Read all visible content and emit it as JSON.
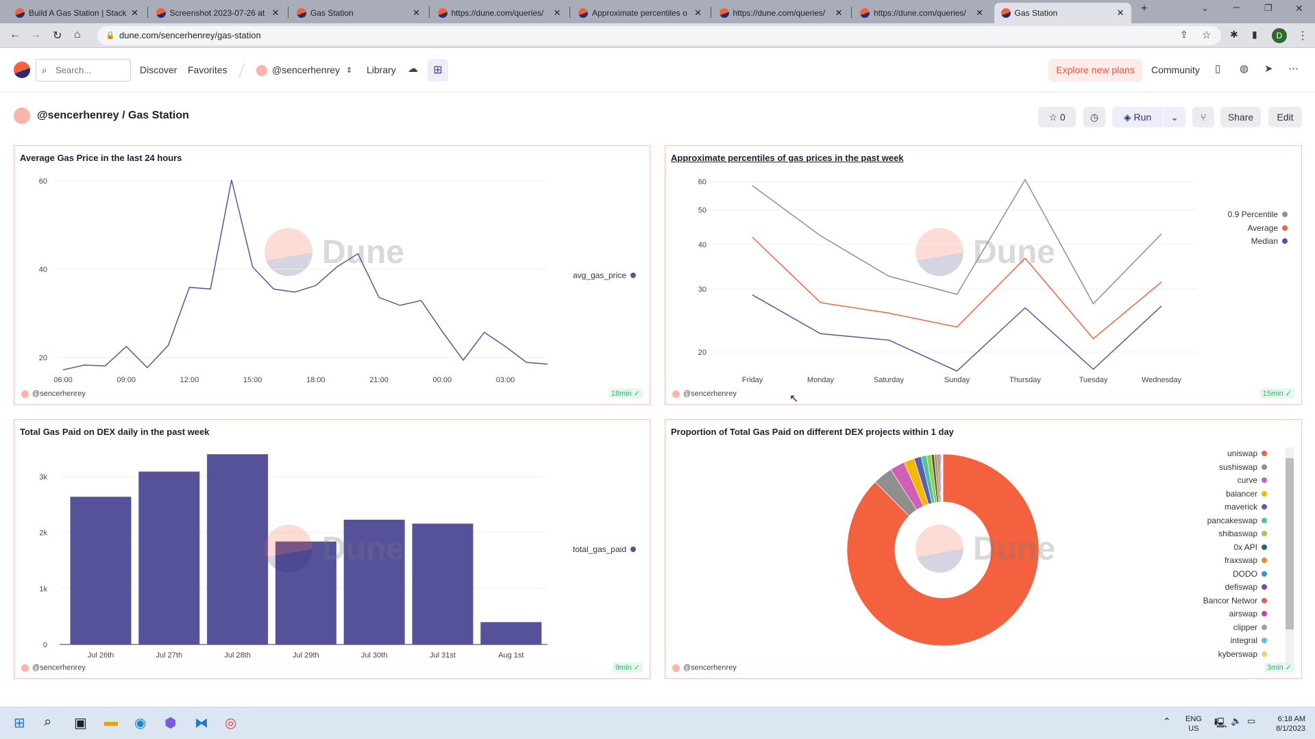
{
  "browser": {
    "tabs": [
      {
        "title": "Build A Gas Station | Stack"
      },
      {
        "title": "Screenshot 2023-07-26 at"
      },
      {
        "title": "Gas Station"
      },
      {
        "title": "https://dune.com/queries/"
      },
      {
        "title": "Approximate percentiles o"
      },
      {
        "title": "https://dune.com/queries/"
      },
      {
        "title": "https://dune.com/queries/"
      },
      {
        "title": "Gas Station",
        "active": true
      }
    ],
    "url": "dune.com/sencerhenrey/gas-station",
    "profile_initial": "D"
  },
  "nav": {
    "search_placeholder": "Search...",
    "discover": "Discover",
    "favorites": "Favorites",
    "user": "@sencerhenrey",
    "library": "Library",
    "explore": "Explore new plans",
    "community": "Community"
  },
  "dashboard": {
    "title": "@sencerhenrey / Gas Station",
    "star_count": "0",
    "run": "Run",
    "share": "Share",
    "edit": "Edit"
  },
  "watermark": "Dune",
  "panels": [
    {
      "title": "Average Gas Price in the last 24 hours",
      "author": "@sencerhenrey",
      "age": "18min"
    },
    {
      "title": "Approximate percentiles of gas prices in the past week",
      "author": "@sencerhenrey",
      "age": "15min"
    },
    {
      "title": "Total Gas Paid on DEX daily in the past week",
      "author": "@sencerhenrey",
      "age": "9min"
    },
    {
      "title": "Proportion of Total Gas Paid on different DEX projects within 1 day",
      "author": "@sencerhenrey",
      "age": "3min"
    }
  ],
  "chart_data": [
    {
      "type": "line",
      "title": "Average Gas Price in the last 24 hours",
      "series": [
        {
          "name": "avg_gas_price",
          "color": "#5b52a3",
          "values": [
            17.2,
            18.3,
            18.1,
            22.5,
            17.7,
            22.8,
            35.9,
            35.5,
            60.2,
            40.5,
            35.5,
            34.8,
            36.3,
            40.5,
            43.5,
            33.6,
            31.8,
            32.9,
            25.9,
            19.4,
            25.7,
            22.5,
            18.9,
            18.5
          ]
        }
      ],
      "x": [
        "06:00",
        "07:00",
        "08:00",
        "09:00",
        "10:00",
        "11:00",
        "12:00",
        "13:00",
        "14:00",
        "15:00",
        "16:00",
        "17:00",
        "18:00",
        "19:00",
        "20:00",
        "21:00",
        "22:00",
        "23:00",
        "00:00",
        "01:00",
        "02:00",
        "03:00",
        "04:00",
        "05:00"
      ],
      "xticks": [
        "06:00",
        "09:00",
        "12:00",
        "15:00",
        "18:00",
        "21:00",
        "00:00",
        "03:00"
      ],
      "yticks": [
        20,
        40,
        60
      ],
      "legend": "right",
      "grid": true
    },
    {
      "type": "line",
      "title": "Approximate percentiles of gas prices in the past week",
      "yscale": "log",
      "categories": [
        "Friday",
        "Monday",
        "Saturday",
        "Sunday",
        "Thursday",
        "Tuesday",
        "Wednesday"
      ],
      "series": [
        {
          "name": "0.9 Percentile",
          "color": "#8f8f8f",
          "values": [
            58.4,
            42.3,
            32.6,
            29.0,
            60.7,
            27.3,
            42.8
          ]
        },
        {
          "name": "Average",
          "color": "#f4613f",
          "values": [
            41.9,
            27.5,
            25.7,
            23.5,
            36.6,
            21.8,
            31.4
          ]
        },
        {
          "name": "Median",
          "color": "#5b52a3",
          "values": [
            28.9,
            22.5,
            21.6,
            17.7,
            26.6,
            17.9,
            26.9
          ]
        }
      ],
      "yticks": [
        20,
        30,
        40,
        50,
        60
      ],
      "legend": "right",
      "grid": true
    },
    {
      "type": "bar",
      "title": "Total Gas Paid on DEX daily in the past week",
      "categories": [
        "Jul 26th",
        "Jul 27th",
        "Jul 28th",
        "Jul 29th",
        "Jul 30th",
        "Jul 31st",
        "Aug 1st"
      ],
      "series": [
        {
          "name": "total_gas_paid",
          "color": "#55529a",
          "values": [
            2640,
            3090,
            3400,
            1840,
            2230,
            2160,
            400
          ]
        }
      ],
      "yticks": [
        "0",
        "1k",
        "2k",
        "3k"
      ],
      "ytick_values": [
        0,
        1000,
        2000,
        3000
      ],
      "legend": "right",
      "grid": true
    },
    {
      "type": "pie",
      "title": "Proportion of Total Gas Paid on different DEX projects within 1 day",
      "donut": true,
      "legend": "right",
      "slices": [
        {
          "label": "uniswap",
          "value": 87.55,
          "color": "#f4613f"
        },
        {
          "label": "sushiswap",
          "value": 3.3,
          "color": "#8f8f8f"
        },
        {
          "label": "curve",
          "value": 2.5,
          "color": "#d05fb5"
        },
        {
          "label": "balancer",
          "value": 1.8,
          "color": "#f5b800"
        },
        {
          "label": "maverick",
          "value": 1.2,
          "color": "#5b5fb0"
        },
        {
          "label": "pancakeswap",
          "value": 0.9,
          "color": "#4cc3a8"
        },
        {
          "label": "shibaswap",
          "value": 0.8,
          "color": "#9dcb44"
        },
        {
          "label": "0x API",
          "value": 0.5,
          "color": "#1d6e5e"
        },
        {
          "label": "fraxswap",
          "value": 0.5,
          "color": "#f18a1c"
        },
        {
          "label": "DODO",
          "value": 0.3,
          "color": "#3a8fd6"
        },
        {
          "label": "defiswap",
          "value": 0.2,
          "color": "#7a4aa8"
        },
        {
          "label": "Bancor Networ",
          "value": 0.15,
          "color": "#f05a5a"
        },
        {
          "label": "airswap",
          "value": 0.1,
          "color": "#d63aa0"
        },
        {
          "label": "clipper",
          "value": 0.1,
          "color": "#a0a0a0"
        },
        {
          "label": "integral",
          "value": 0.05,
          "color": "#4cc3d8"
        },
        {
          "label": "kyberswap",
          "value": 0.05,
          "color": "#f5d060"
        }
      ]
    }
  ],
  "taskbar": {
    "lang1": "ENG",
    "lang2": "US",
    "time": "6:18 AM",
    "date": "8/1/2023"
  }
}
